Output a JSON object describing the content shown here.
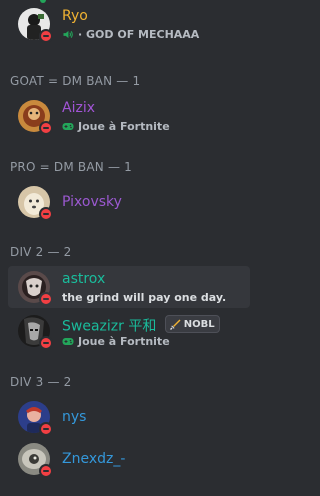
{
  "colors": {
    "background": "#2b2d31",
    "hover": "#35373c",
    "dnd_status": "#f23f43",
    "online_status": "#23a55a",
    "section_header": "#949ba4"
  },
  "members_top": [
    {
      "name": "Ryo",
      "name_color": "#f0b232",
      "subline": "· GOD OF MECHAAA",
      "subline_icon": "speaker-icon",
      "status": "dnd"
    }
  ],
  "sections": [
    {
      "header": "GOAT = DM BAN — 1",
      "members": [
        {
          "name": "Aizix",
          "name_color": "#a254d6",
          "subline": "Joue à Fortnite",
          "subline_icon": "gamepad-icon",
          "status": "dnd"
        }
      ]
    },
    {
      "header": "PRO = DM BAN — 1",
      "members": [
        {
          "name": "Pixovsky",
          "name_color": "#9b59d0",
          "status": "dnd"
        }
      ]
    },
    {
      "header": "DIV 2 — 2",
      "members": [
        {
          "name": "astrox",
          "name_color": "#1abc9c",
          "subline": "the grind will pay one day.",
          "status": "dnd"
        },
        {
          "name": "Sweazizr 平和",
          "name_color": "#1abc9c",
          "badge": "NOBL",
          "badge_icon": "sword-icon",
          "subline": "Joue à Fortnite",
          "subline_icon": "gamepad-icon",
          "status": "dnd"
        }
      ]
    },
    {
      "header": "DIV 3 — 2",
      "members": [
        {
          "name": "nys",
          "name_color": "#3498db",
          "status": "dnd"
        },
        {
          "name": "Znexdz_-",
          "name_color": "#3498db",
          "status": "dnd"
        }
      ]
    }
  ]
}
